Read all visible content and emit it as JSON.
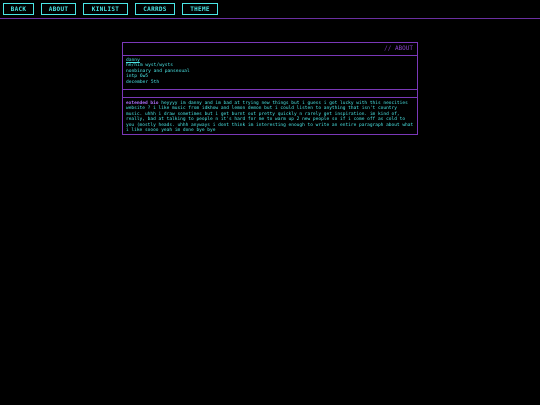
{
  "nav": {
    "back": "BACK",
    "about": "ABOUT",
    "kinlist": "KINLIST",
    "carrds": "CARRDS",
    "theme": "THEME"
  },
  "panel": {
    "header_slashes": "//",
    "header_title": "ABOUT"
  },
  "info": {
    "name": "danny",
    "pronouns": "he/him wyst/wysts",
    "identity": "nonbinary and pansexual",
    "mbti": "intp 6w5",
    "birthday": "december 5th"
  },
  "bio": {
    "label": "extended bio",
    "text": "heyyyy im danny and im bad at trying new things but i guess i got lucky with this neocities website ? i like music from idkhow and lemon demon but i could listen to anything that isn't country music. uhhh i draw sometimes but i get burnt out pretty quickly n rarely get inspiration. im kind of, really, bad at talking to people n it's hard for me to warm up 2 new people so if i come off as cold to you (mostly heads. uhhh anyways i dont think im interesting enough to write an entire paragraph about what i like soooo yeah im done bye bye"
  },
  "colors": {
    "accent_cyan": "#4ae6e6",
    "accent_purple": "#7a38b8",
    "background": "#000000"
  }
}
